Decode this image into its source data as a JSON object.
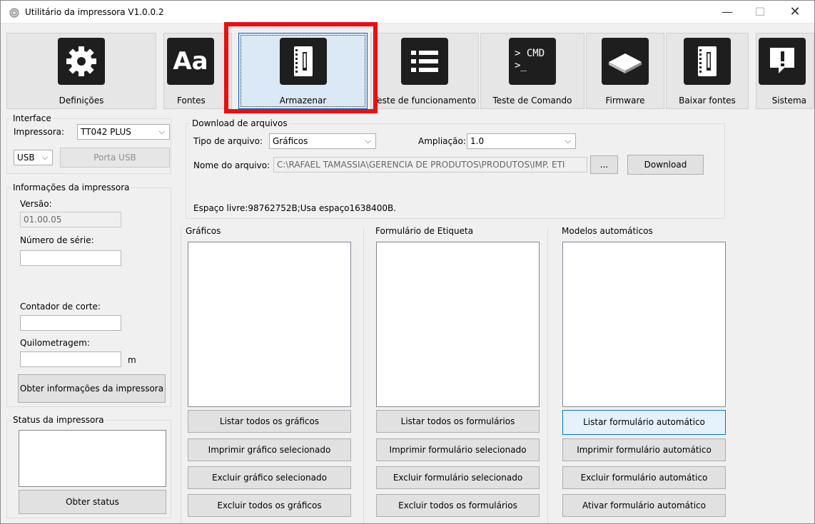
{
  "window": {
    "title": "Utilitário da impressora  V1.0.0.2",
    "min_glyph": "—",
    "max_glyph": "☐",
    "close_glyph": "✕"
  },
  "toolbar": {
    "items": [
      {
        "label": "Definições",
        "icon": "gear-icon"
      },
      {
        "label": "Fontes",
        "icon": "font-icon",
        "glyph": "Aa"
      },
      {
        "label": "Armazenar",
        "icon": "storage-icon",
        "selected": true
      },
      {
        "label": "Teste de funcionamento",
        "icon": "list-icon"
      },
      {
        "label": "Teste de Comando",
        "icon": "cmd-icon",
        "glyph": "> CMD\n>_"
      },
      {
        "label": "Firmware",
        "icon": "chip-icon"
      },
      {
        "label": "Baixar fontes",
        "icon": "download-fonts-icon"
      },
      {
        "label": "Sistema",
        "icon": "alert-icon"
      }
    ],
    "highlight_color": "#e81010"
  },
  "interface": {
    "title": "Interface",
    "printer_label": "Impressora:",
    "printer_value": "TT042 PLUS",
    "port_value": "USB",
    "usb_port_button": "Porta USB"
  },
  "info": {
    "title": "Informações da impressora",
    "version_label": "Versão:",
    "version_value": "01.00.05",
    "serial_label": "Número de série:",
    "serial_value": "",
    "cut_counter_label": "Contador de corte:",
    "cut_counter_value": "",
    "mileage_label": "Quilometragem:",
    "mileage_value": "",
    "mileage_unit": "m",
    "get_info_button": "Obter informações da impressora"
  },
  "status": {
    "title": "Status da impressora",
    "get_status_button": "Obter status"
  },
  "download": {
    "title": "Download de arquivos",
    "file_type_label": "Tipo de arquivo:",
    "file_type_value": "Gráficos",
    "zoom_label": "Ampliação:",
    "zoom_value": "1.0",
    "filename_label": "Nome do arquivo:",
    "filename_value": "C:\\RAFAEL TAMASSIA\\GERENCIA DE PRODUTOS\\PRODUTOS\\IMP. ETI",
    "browse_button": "...",
    "download_button": "Download",
    "space_text": "Espaço livre:98762752B;Usa espaço1638400B."
  },
  "graphics": {
    "title": "Gráficos",
    "buttons": [
      "Listar todos os gráficos",
      "Imprimir gráfico selecionado",
      "Excluir gráfico selecionado",
      "Excluir todos os gráficos"
    ]
  },
  "forms": {
    "title": "Formulário de Etiqueta",
    "buttons": [
      "Listar todos os formulários",
      "Imprimir formulário selecionado",
      "Excluir formulário selecionado",
      "Excluir todos os formulários"
    ]
  },
  "auto": {
    "title": "Modelos automáticos",
    "buttons": [
      "Listar formulário automático",
      "Imprimir formulário automático",
      "Excluir formulário automático",
      "Ativar formulário automático"
    ]
  }
}
